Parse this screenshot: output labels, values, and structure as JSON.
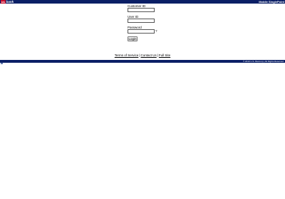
{
  "header": {
    "logo_us": "us",
    "logo_bank": "bank",
    "app_title": "Mobile SinglePoint",
    "bar_color": "#0b1f66",
    "logo_red": "#c8102e"
  },
  "form": {
    "customer_id_label": "Customer ID",
    "customer_id_value": "",
    "user_id_label": "User ID",
    "user_id_value": "",
    "password_label": "Password",
    "password_value": "",
    "help_icon": "?",
    "login_label": "Login"
  },
  "footer": {
    "links": [
      "Terms of Service",
      "Contact Us",
      "Full Site"
    ],
    "separator": "|",
    "copyright": "© 2010 U.S. Bancorp | All Rights Reserved"
  }
}
